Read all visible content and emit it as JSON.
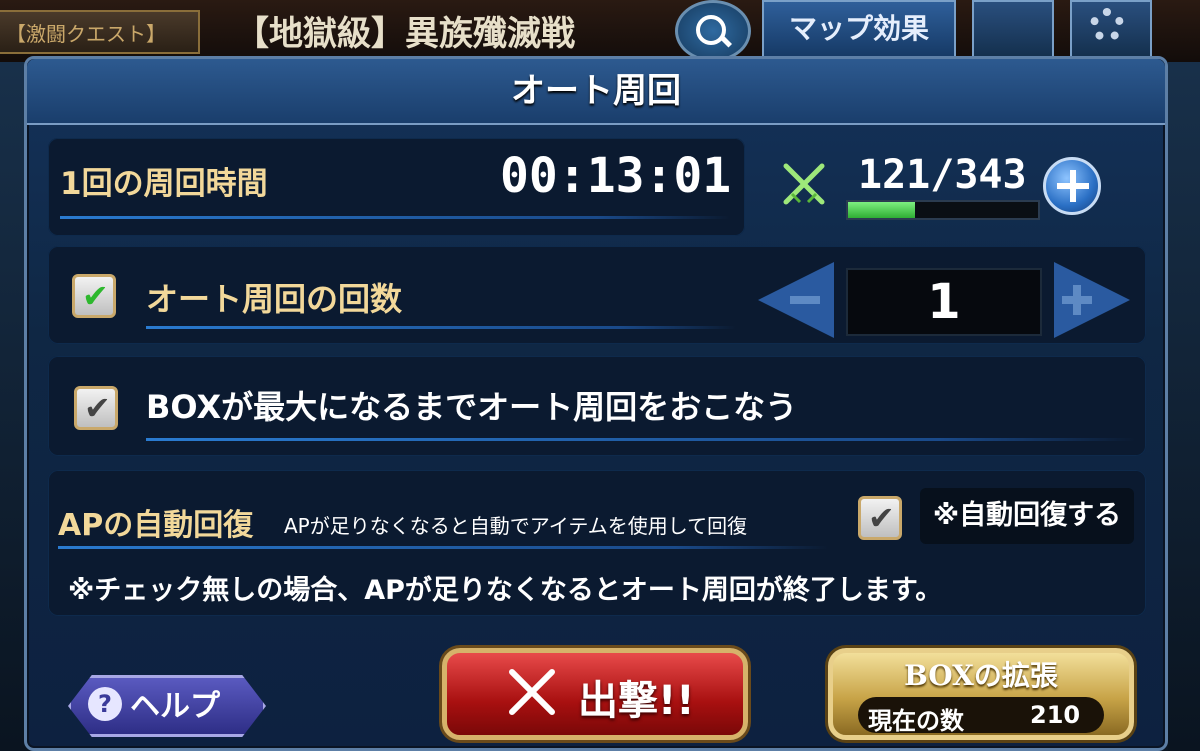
{
  "background": {
    "quest_tag": "【激闘クエスト】",
    "quest_title": "【地獄級】異族殲滅戦",
    "map_effect_button": "マップ効果"
  },
  "dialog": {
    "title": "オート周回",
    "loop_time": {
      "label": "1回の周回時間",
      "value": "00:13:01"
    },
    "stamina": {
      "text": "121/343",
      "fraction": 0.353,
      "icon": "crossed-swords-icon",
      "plus_icon": "plus-icon"
    },
    "auto_count": {
      "checked": true,
      "label": "オート周回の回数",
      "value": "1"
    },
    "until_box_full": {
      "checked": true,
      "label": "BOXが最大になるまでオート周回をおこなう"
    },
    "ap_recovery": {
      "label": "APの自動回復",
      "description": "APが足りなくなると自動でアイテムを使用して回復",
      "checked": true,
      "tag": "※自動回復する",
      "note": "※チェック無しの場合、APが足りなくなるとオート周回が終了します。"
    },
    "help_button": "ヘルプ",
    "sortie_button": "出撃!!",
    "box_expand": {
      "title": "BOXの拡張",
      "count_label": "現在の数",
      "count_value": "210"
    }
  },
  "colors": {
    "panel": "#0f2744",
    "accent_gold": "#f2d89a",
    "sortie_red": "#c81e1e",
    "stamina_green": "#2fae34"
  }
}
